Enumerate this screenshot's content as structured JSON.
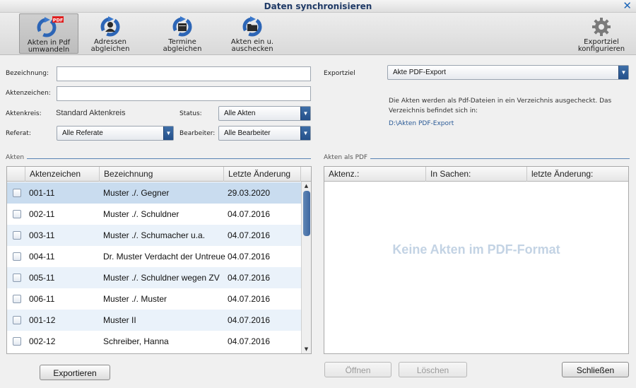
{
  "window": {
    "title": "Daten synchronisieren"
  },
  "toolbar": {
    "buttons": [
      {
        "label_line1": "Akten in Pdf",
        "label_line2": "umwandeln",
        "icon": "sync-pdf-icon",
        "badge": "PDF"
      },
      {
        "label_line1": "Adressen",
        "label_line2": "abgleichen",
        "icon": "sync-contacts-icon"
      },
      {
        "label_line1": "Termine",
        "label_line2": "abgleichen",
        "icon": "sync-calendar-icon"
      },
      {
        "label_line1": "Akten ein u.",
        "label_line2": "auschecken",
        "icon": "sync-folder-icon"
      },
      {
        "label_line1": "Exportziel",
        "label_line2": "konfigurieren",
        "icon": "gear-icon"
      }
    ]
  },
  "filters": {
    "bezeichnung_label": "Bezeichnung:",
    "bezeichnung_value": "",
    "aktenzeichen_label": "Aktenzeichen:",
    "aktenzeichen_value": "",
    "aktenkreis_label": "Aktenkreis:",
    "aktenkreis_value": "Standard Aktenkreis",
    "status_label": "Status:",
    "status_value": "Alle Akten",
    "referat_label": "Referat:",
    "referat_value": "Alle Referate",
    "bearbeiter_label": "Bearbeiter:",
    "bearbeiter_value": "Alle Bearbeiter"
  },
  "export": {
    "ziel_label": "Exportziel",
    "ziel_value": "Akte PDF-Export",
    "info_line1": "Die Akten werden als Pdf-Dateien in ein Verzeichnis ausgecheckt. Das",
    "info_line2": "Verzeichnis befindet sich in:",
    "path": "D:\\Akten PDF-Export"
  },
  "akten": {
    "section_title": "Akten",
    "columns": [
      "Aktenzeichen",
      "Bezeichnung",
      "Letzte Änderung"
    ],
    "rows": [
      {
        "az": "001-11",
        "bez": "Muster ./. Gegner",
        "date": "29.03.2020"
      },
      {
        "az": "002-11",
        "bez": "Muster ./. Schuldner",
        "date": "04.07.2016"
      },
      {
        "az": "003-11",
        "bez": "Muster ./. Schumacher u.a.",
        "date": "04.07.2016"
      },
      {
        "az": "004-11",
        "bez": "Dr. Muster Verdacht der Untreue",
        "date": "04.07.2016"
      },
      {
        "az": "005-11",
        "bez": "Muster ./. Schuldner wegen ZV",
        "date": "04.07.2016"
      },
      {
        "az": "006-11",
        "bez": "Muster ./. Muster",
        "date": "04.07.2016"
      },
      {
        "az": "001-12",
        "bez": "Muster II",
        "date": "04.07.2016"
      },
      {
        "az": "002-12",
        "bez": "Schreiber, Hanna",
        "date": "04.07.2016"
      }
    ],
    "export_button": "Exportieren"
  },
  "pdf": {
    "section_title": "Akten als PDF",
    "columns": [
      "Aktenz.:",
      "In Sachen:",
      "letzte Änderung:"
    ],
    "empty_message": "Keine Akten im PDF-Format",
    "open_button": "Öffnen",
    "delete_button": "Löschen"
  },
  "footer": {
    "close_button": "Schließen"
  }
}
